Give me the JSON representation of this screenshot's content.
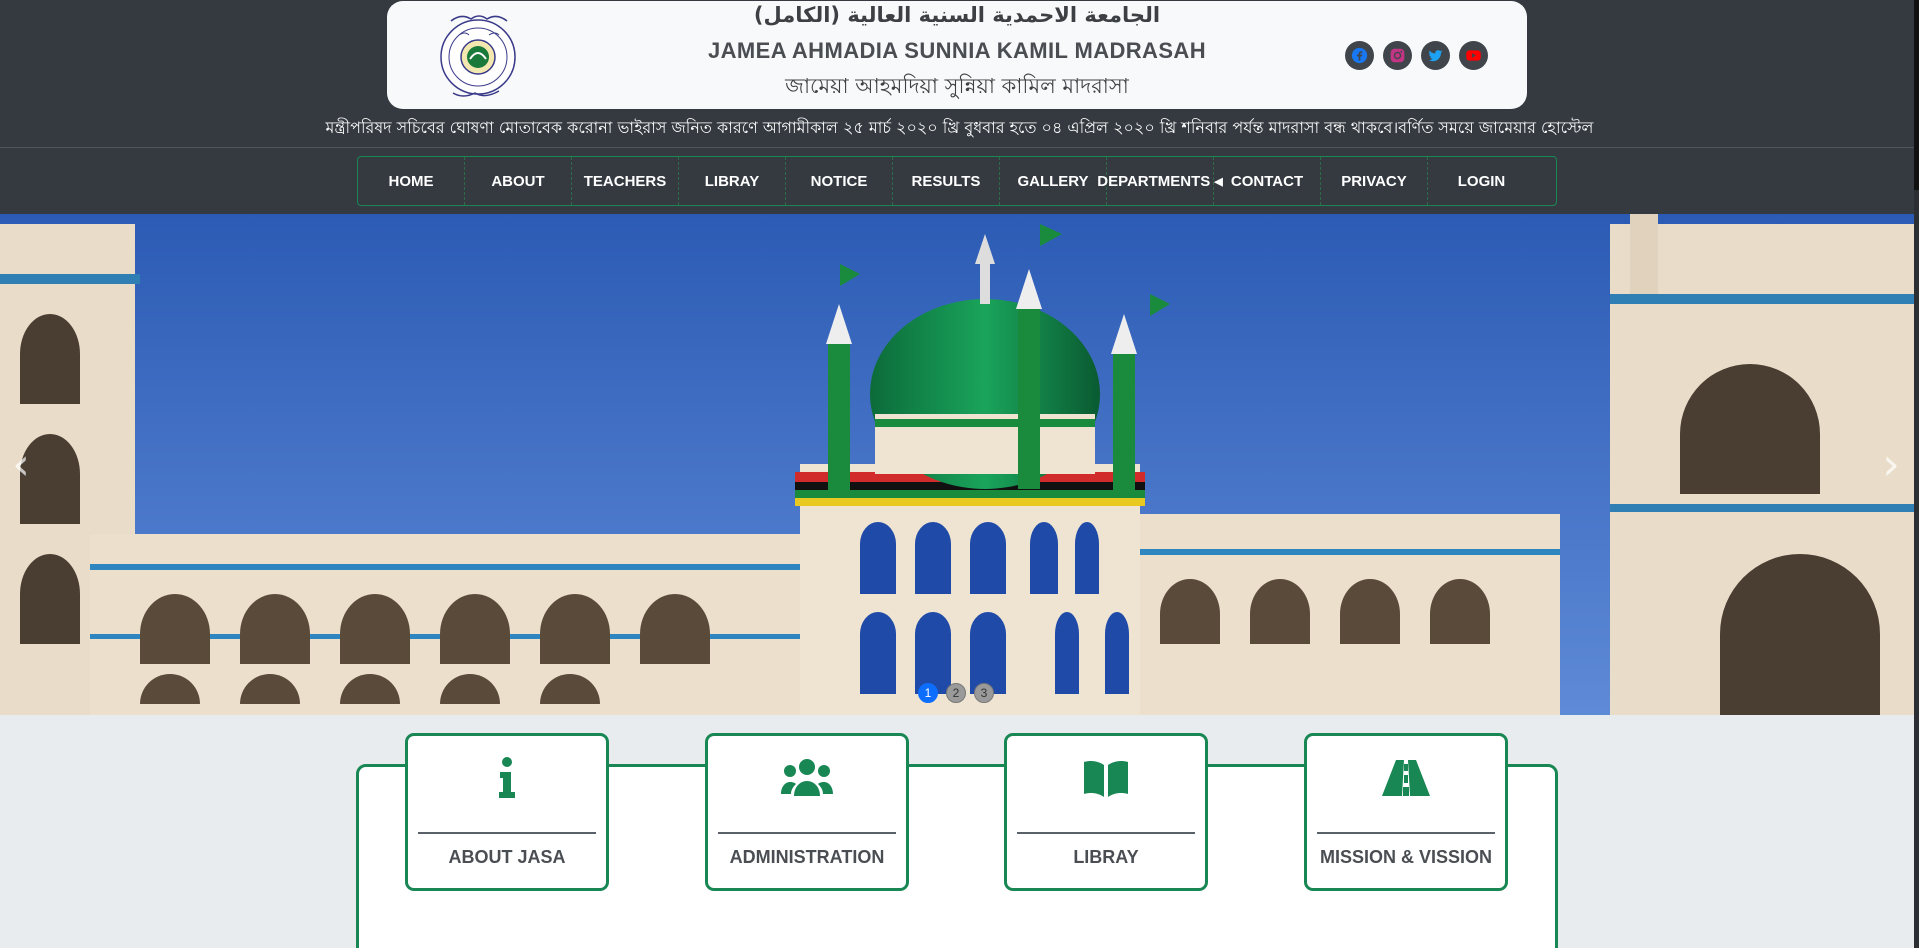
{
  "header": {
    "title_arabic": "الجامعة الاحمدية السنية العالية (الكامل)",
    "title_english": "JAMEA AHMADIA SUNNIA KAMIL MADRASAH",
    "title_bengali": "জামেয়া আহমদিয়া সুন্নিয়া কামিল মাদরাসা",
    "logo_icon": "madrasah-seal-logo",
    "socials": [
      {
        "name": "facebook-icon",
        "color": "#1877f2"
      },
      {
        "name": "instagram-icon",
        "color": "#c13584"
      },
      {
        "name": "twitter-icon",
        "color": "#1da1f2"
      },
      {
        "name": "youtube-icon",
        "color": "#ff0000"
      }
    ]
  },
  "notice_marquee": "মন্ত্রীপরিষদ সচিবের ঘোষণা মোতাবেক করোনা ভাইরাস জনিত কারণে আগামীকাল ২৫ মার্চ ২০২০ খ্রি বুধবার হতে ০৪ এপ্রিল ২০২০ খ্রি শনিবার পর্যন্ত মাদরাসা বন্ধ থাকবে।বর্ণিত সময়ে জামেয়ার হোস্টেল",
  "nav": {
    "items": [
      "HOME",
      "ABOUT",
      "TEACHERS",
      "LIBRAY",
      "NOTICE",
      "RESULTS",
      "GALLERY",
      "DEPARTMENTS",
      "CONTACT",
      "PRIVACY",
      "LOGIN"
    ]
  },
  "carousel": {
    "prev_icon": "chevron-left-icon",
    "next_icon": "chevron-right-icon",
    "indicators": [
      "1",
      "2",
      "3"
    ],
    "active_index": 0
  },
  "cards": [
    {
      "label": "ABOUT JASA",
      "icon": "info-icon"
    },
    {
      "label": "ADMINISTRATION",
      "icon": "users-icon"
    },
    {
      "label": "LIBRAY",
      "icon": "book-open-icon"
    },
    {
      "label": "MISSION & VISSION",
      "icon": "road-icon"
    }
  ],
  "colors": {
    "accent_green": "#198754",
    "topbar": "#343a40",
    "page_bg": "#e9ecef",
    "active_dot": "#0d6efd"
  }
}
